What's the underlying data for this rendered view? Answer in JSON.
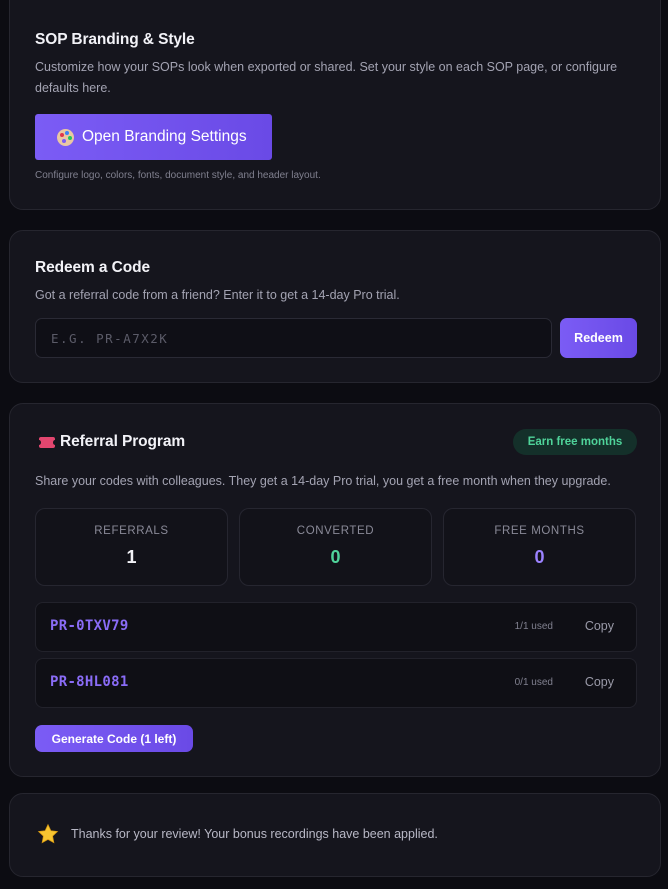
{
  "branding": {
    "title": "SOP Branding & Style",
    "description": "Customize how your SOPs look when exported or shared. Set your style on each SOP page, or configure defaults here.",
    "button_label": "Open Branding Settings",
    "button_icon": "palette-icon",
    "hint": "Configure logo, colors, fonts, document style, and header layout."
  },
  "redeem": {
    "title": "Redeem a Code",
    "description": "Got a referral code from a friend? Enter it to get a 14-day Pro trial.",
    "input_placeholder": "E.G. PR-A7X2K",
    "input_value": "",
    "button_label": "Redeem"
  },
  "referral": {
    "title": "Referral Program",
    "title_icon": "ticket-icon",
    "badge": "Earn free months",
    "description": "Share your codes with colleagues. They get a 14-day Pro trial, you get a free month when they upgrade.",
    "stats": [
      {
        "label": "REFERRALS",
        "value": "1",
        "color": "#f2f2f7"
      },
      {
        "label": "CONVERTED",
        "value": "0",
        "color": "#4fd39a"
      },
      {
        "label": "FREE MONTHS",
        "value": "0",
        "color": "#9b82ff"
      }
    ],
    "codes": [
      {
        "code": "PR-0TXV79",
        "used": "1/1 used",
        "copy_label": "Copy"
      },
      {
        "code": "PR-8HL081",
        "used": "0/1 used",
        "copy_label": "Copy"
      }
    ],
    "generate_label": "Generate Code (1 left)"
  },
  "review": {
    "icon": "star-icon",
    "message": "Thanks for your review! Your bonus recordings have been applied."
  },
  "colors": {
    "accent": "#7b5cf5",
    "background": "#0c0c12",
    "card": "#15151d",
    "success": "#4fd39a"
  }
}
